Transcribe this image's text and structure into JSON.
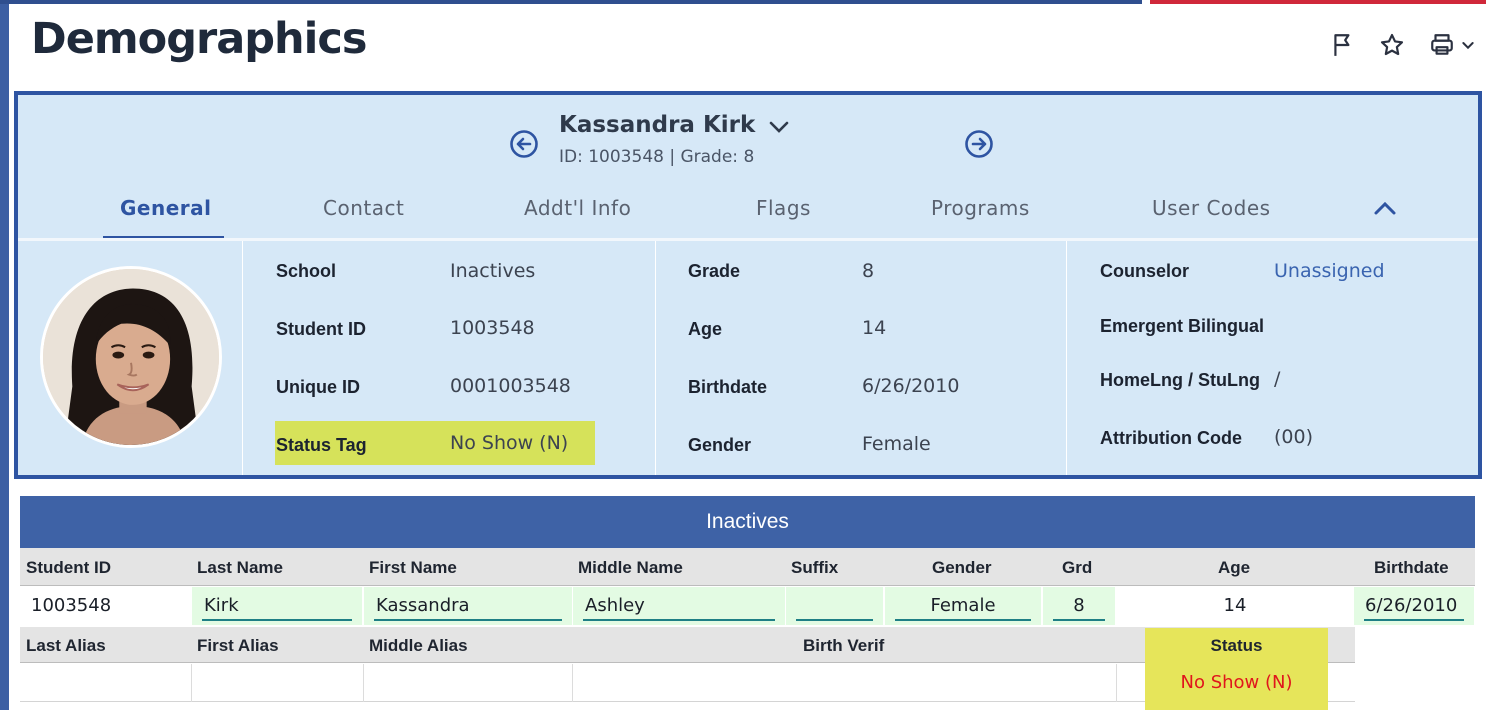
{
  "page": {
    "title": "Demographics"
  },
  "toolbar": {
    "flag_icon": "flag-icon",
    "star_icon": "star-icon",
    "print_icon": "printer-icon",
    "print_chevron": "chevron-down-icon"
  },
  "student": {
    "name": "Kassandra Kirk",
    "subtitle": "ID: 1003548 | Grade: 8"
  },
  "tabs": [
    {
      "label": "General",
      "active": true
    },
    {
      "label": "Contact"
    },
    {
      "label": "Addt'l Info"
    },
    {
      "label": "Flags"
    },
    {
      "label": "Programs"
    },
    {
      "label": "User Codes"
    }
  ],
  "general": {
    "col1": [
      {
        "label": "School",
        "value": "Inactives"
      },
      {
        "label": "Student ID",
        "value": "1003548"
      },
      {
        "label": "Unique ID",
        "value": "0001003548"
      },
      {
        "label": "Status Tag",
        "value": "No Show (N)"
      }
    ],
    "col2": [
      {
        "label": "Grade",
        "value": "8"
      },
      {
        "label": "Age",
        "value": "14"
      },
      {
        "label": "Birthdate",
        "value": "6/26/2010"
      },
      {
        "label": "Gender",
        "value": "Female"
      }
    ],
    "col3": [
      {
        "label": "Counselor",
        "value": "Unassigned"
      },
      {
        "label": "Emergent Bilingual",
        "value": ""
      },
      {
        "label": "HomeLng / StuLng",
        "value": "/"
      },
      {
        "label": "Attribution Code",
        "value": "(00)"
      }
    ]
  },
  "panel": {
    "title": "Inactives",
    "headers": [
      "Student ID",
      "Last Name",
      "First Name",
      "Middle Name",
      "Suffix",
      "Gender",
      "Grd",
      "Age",
      "Birthdate"
    ],
    "row": {
      "student_id": "1003548",
      "last_name": "Kirk",
      "first_name": "Kassandra",
      "middle_name": "Ashley",
      "suffix": "",
      "gender": "Female",
      "grade": "8",
      "age": "14",
      "birthdate": "6/26/2010"
    },
    "headers2": [
      "Last Alias",
      "First Alias",
      "Middle Alias",
      "Birth Verif",
      "Status"
    ],
    "row2": {
      "last_alias": "",
      "first_alias": "",
      "middle_alias": "",
      "birth_verif": "",
      "status": "No Show (N)"
    }
  },
  "colors": {
    "accent": "#2e54a2",
    "card_bg": "#d6e8f7",
    "highlight": "#d6e25a",
    "status_red": "#e0161c",
    "editable_bg": "#e3fbe3"
  }
}
